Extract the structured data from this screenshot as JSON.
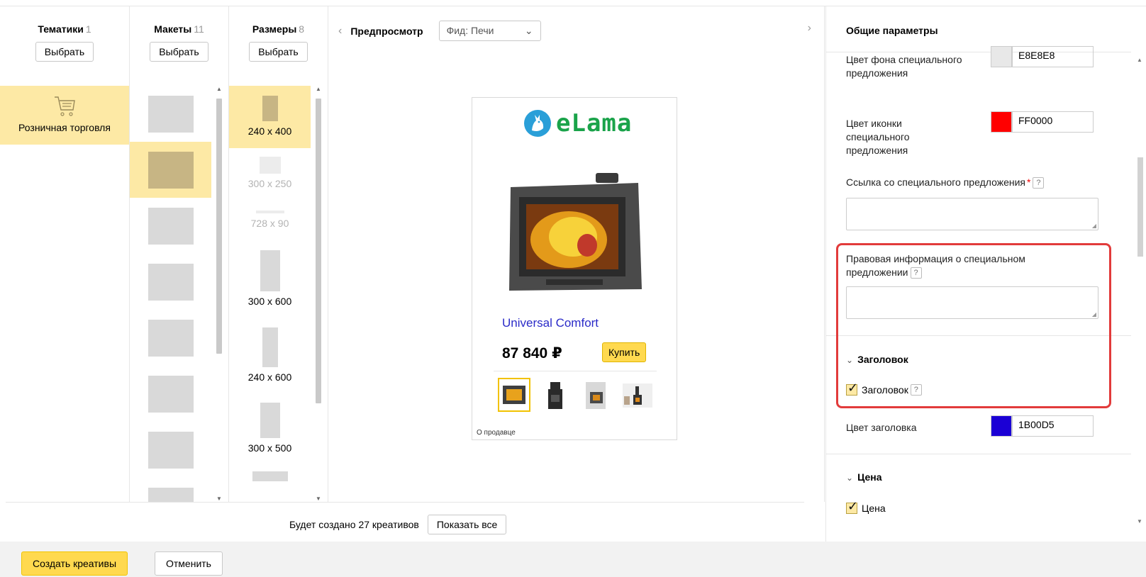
{
  "columns": {
    "themes": {
      "title": "Тематики",
      "count": "1",
      "button": "Выбрать",
      "items": [
        "Розничная торговля"
      ]
    },
    "layouts": {
      "title": "Макеты",
      "count": "11",
      "button": "Выбрать"
    },
    "sizes": {
      "title": "Размеры",
      "count": "8",
      "button": "Выбрать",
      "items": [
        "240 x 400",
        "300 x 250",
        "728 x 90",
        "300 x 600",
        "240 x 600",
        "300 x 500"
      ]
    }
  },
  "preview": {
    "title": "Предпросмотр",
    "feed": "Фид: Печи",
    "banner": {
      "logo": "eLama",
      "product_title": "Universal Comfort",
      "price": "87 840 ₽",
      "buy": "Купить",
      "seller": "О продавце"
    }
  },
  "footer": {
    "create_info": "Будет создано 27 креативов",
    "show_all": "Показать все",
    "create_button": "Создать креативы",
    "cancel_button": "Отменить"
  },
  "params": {
    "title": "Общие параметры",
    "bg_color_label": "Цвет фона специального предложения",
    "bg_color_value": "E8E8E8",
    "icon_color_label": "Цвет иконки специального предложения",
    "icon_color_value": "FF0000",
    "link_label": "Ссылка со специального предложения",
    "required_mark": "*",
    "legal_label": "Правовая информация о специальном предложении",
    "help": "?",
    "section_title": "Заголовок",
    "checkbox_title": "Заголовок",
    "title_color_label": "Цвет заголовка",
    "title_color_value": "1B00D5",
    "section_price": "Цена",
    "checkbox_price": "Цена"
  },
  "colors": {
    "accent": "#ffd94f",
    "selected": "#fde9a5",
    "highlight": "#e23b3b",
    "title_color": "#1b00d5",
    "icon_color": "#ff0000",
    "bg_color": "#e8e8e8",
    "link": "#2b2bc8"
  }
}
